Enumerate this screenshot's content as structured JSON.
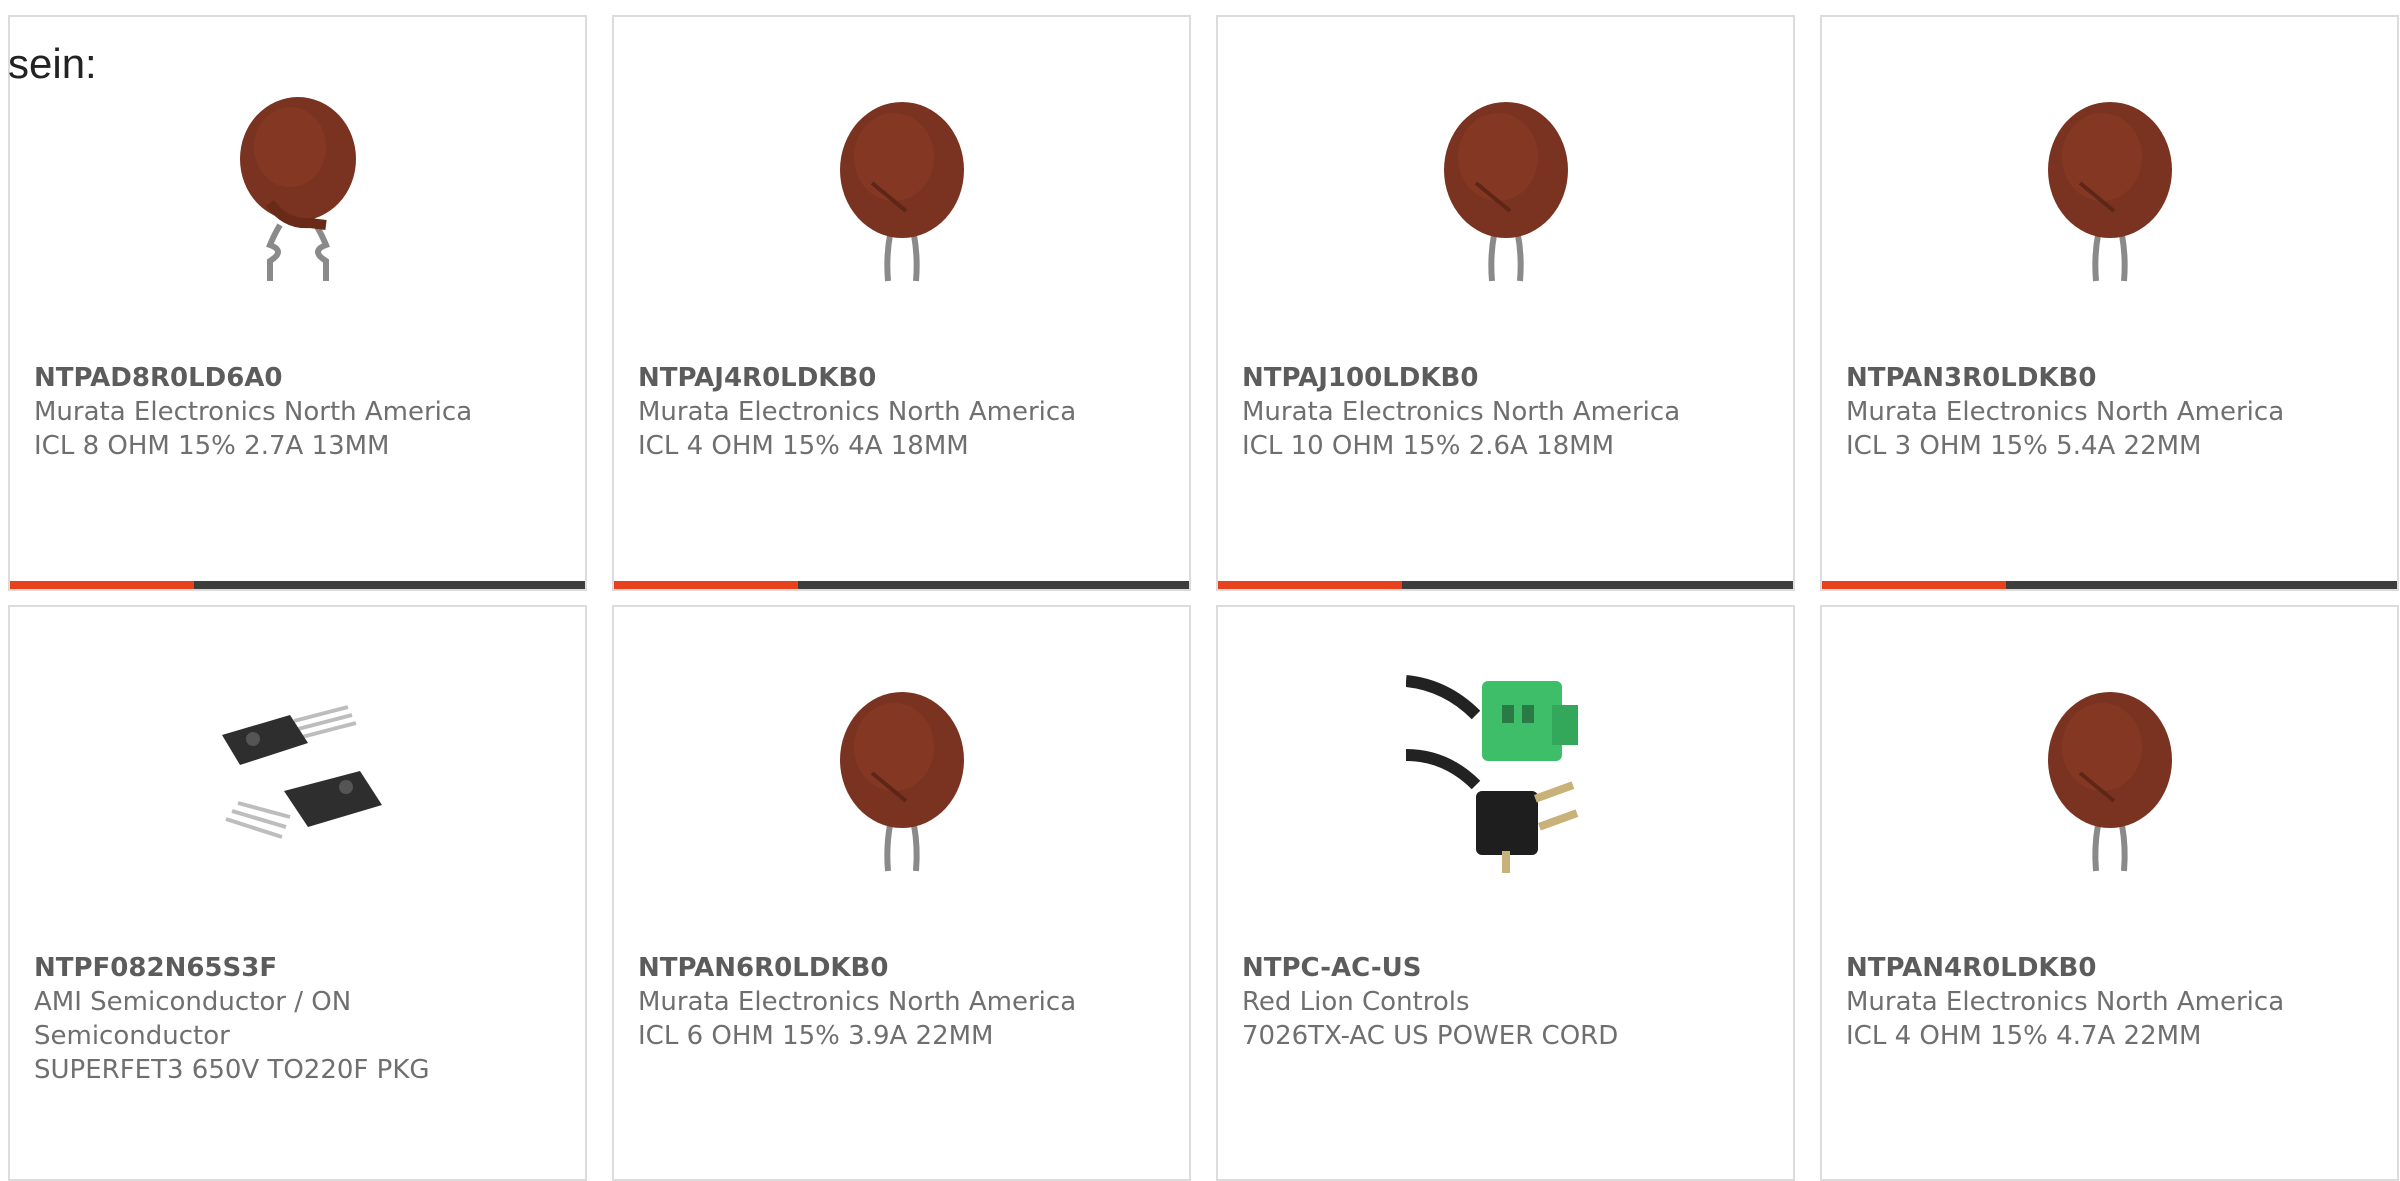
{
  "prefix_text": "sein:",
  "colors": {
    "accent": "#e8411d",
    "bar_track": "#3d3d3d",
    "border": "#dcdcdc",
    "text": "#6f6f6f"
  },
  "products": [
    {
      "part_number": "NTPAD8R0LD6A0",
      "manufacturer": "Murata Electronics North America",
      "description": "ICL 8 OHM 15% 2.7A 13MM",
      "image": "thermistor-bent-leads-icon",
      "progress": 0.32
    },
    {
      "part_number": "NTPAJ4R0LDKB0",
      "manufacturer": "Murata Electronics North America",
      "description": "ICL 4 OHM 15% 4A 18MM",
      "image": "thermistor-icon",
      "progress": 0.32
    },
    {
      "part_number": "NTPAJ100LDKB0",
      "manufacturer": "Murata Electronics North America",
      "description": "ICL 10 OHM 15% 2.6A 18MM",
      "image": "thermistor-icon",
      "progress": 0.32
    },
    {
      "part_number": "NTPAN3R0LDKB0",
      "manufacturer": "Murata Electronics North America",
      "description": "ICL 3 OHM 15% 5.4A 22MM",
      "image": "thermistor-icon",
      "progress": 0.32
    },
    {
      "part_number": "NTPF082N65S3F",
      "manufacturer": "AMI Semiconductor / ON Semiconductor",
      "description": "SUPERFET3 650V TO220F PKG",
      "image": "transistor-to220-icon"
    },
    {
      "part_number": "NTPAN6R0LDKB0",
      "manufacturer": "Murata Electronics North America",
      "description": "ICL 6 OHM 15% 3.9A 22MM",
      "image": "thermistor-icon"
    },
    {
      "part_number": "NTPC-AC-US",
      "manufacturer": "Red Lion Controls",
      "description": "7026TX-AC US POWER CORD",
      "image": "power-cord-icon"
    },
    {
      "part_number": "NTPAN4R0LDKB0",
      "manufacturer": "Murata Electronics North America",
      "description": "ICL 4 OHM 15% 4.7A 22MM",
      "image": "thermistor-icon"
    }
  ]
}
